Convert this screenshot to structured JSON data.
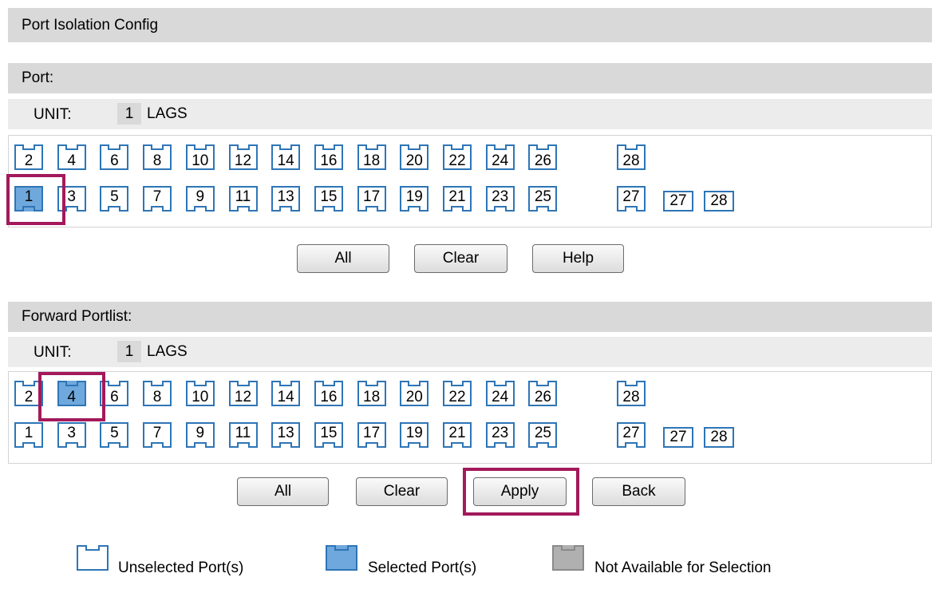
{
  "title": "Port Isolation Config",
  "port_section": {
    "header": "Port:",
    "unit_label": "UNIT:",
    "unit_value": "1",
    "lags_label": "LAGS",
    "top_ports": [
      "2",
      "4",
      "6",
      "8",
      "10",
      "12",
      "14",
      "16",
      "18",
      "20",
      "22",
      "24",
      "26",
      "28"
    ],
    "bottom_ports": [
      "1",
      "3",
      "5",
      "7",
      "9",
      "11",
      "13",
      "15",
      "17",
      "19",
      "21",
      "23",
      "25",
      "27"
    ],
    "lag_ports": [
      "27",
      "28"
    ],
    "selected": [
      "1"
    ],
    "buttons": {
      "all": "All",
      "clear": "Clear",
      "help": "Help"
    }
  },
  "forward_section": {
    "header": "Forward Portlist:",
    "unit_label": "UNIT:",
    "unit_value": "1",
    "lags_label": "LAGS",
    "top_ports": [
      "2",
      "4",
      "6",
      "8",
      "10",
      "12",
      "14",
      "16",
      "18",
      "20",
      "22",
      "24",
      "26",
      "28"
    ],
    "bottom_ports": [
      "1",
      "3",
      "5",
      "7",
      "9",
      "11",
      "13",
      "15",
      "17",
      "19",
      "21",
      "23",
      "25",
      "27"
    ],
    "lag_ports": [
      "27",
      "28"
    ],
    "selected": [
      "4"
    ],
    "buttons": {
      "all": "All",
      "clear": "Clear",
      "apply": "Apply",
      "back": "Back"
    }
  },
  "legend": {
    "unselected": "Unselected Port(s)",
    "selected": "Selected Port(s)",
    "unavailable": "Not Available for Selection"
  },
  "colors": {
    "port_border": "#2e75b6",
    "selected_fill": "#6fa8dc",
    "unavailable_fill": "#b0b0b0",
    "highlight": "#a3195b"
  }
}
